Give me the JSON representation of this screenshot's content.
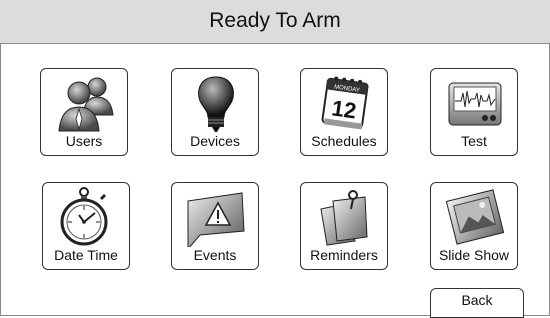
{
  "header": {
    "title": "Ready To Arm"
  },
  "tiles": [
    {
      "label": "Users",
      "icon": "users-icon"
    },
    {
      "label": "Devices",
      "icon": "lightbulb-icon"
    },
    {
      "label": "Schedules",
      "icon": "calendar-icon",
      "calendar_day": "MONDAY",
      "calendar_date": "12"
    },
    {
      "label": "Test",
      "icon": "monitor-waveform-icon"
    },
    {
      "label": "Date Time",
      "icon": "stopwatch-icon"
    },
    {
      "label": "Events",
      "icon": "warning-flag-icon"
    },
    {
      "label": "Reminders",
      "icon": "sticky-notes-icon"
    },
    {
      "label": "Slide Show",
      "icon": "picture-frame-icon"
    }
  ],
  "footer": {
    "back_label": "Back"
  },
  "colors": {
    "title_bar": "#dcdcdc",
    "border": "#333333",
    "background": "#ffffff"
  }
}
